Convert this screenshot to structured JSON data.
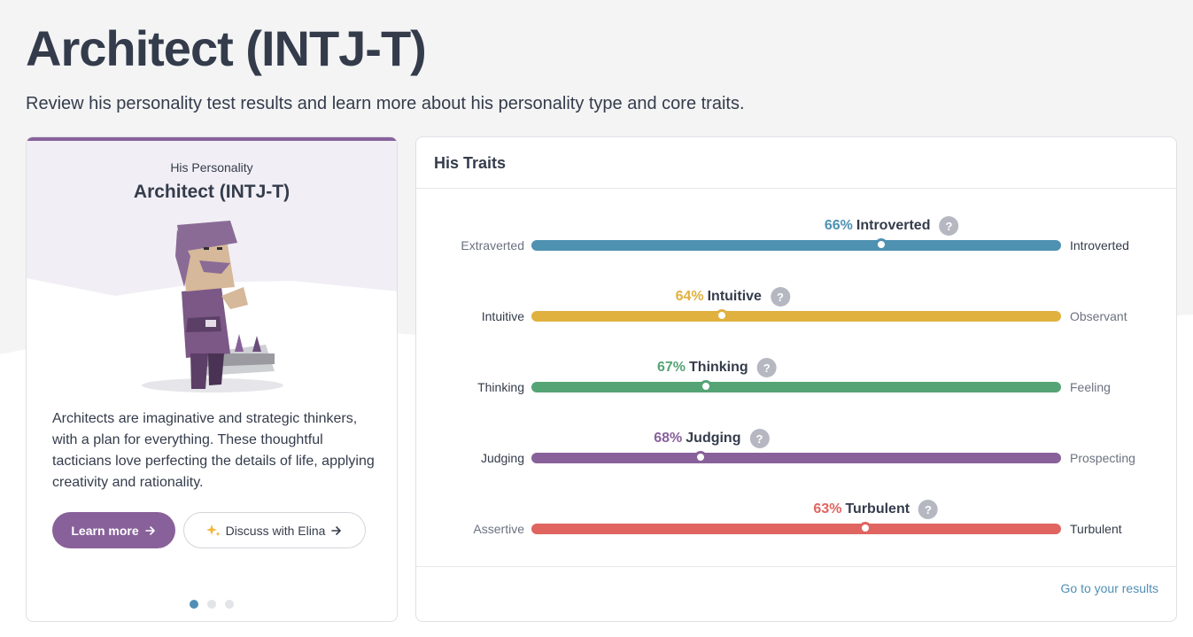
{
  "page": {
    "title": "Architect (INTJ-T)",
    "subtitle": "Review his personality test results and learn more about his personality type and core traits."
  },
  "personality_card": {
    "kicker": "His Personality",
    "type": "Architect (INTJ-T)",
    "description": "Architects are imaginative and strategic thinkers, with a plan for everything. These thoughtful tacticians love perfecting the details of life, applying creativity and rationality.",
    "learn_more_label": "Learn more",
    "discuss_label": "Discuss with Elina",
    "carousel_dots": 3,
    "active_dot": 0,
    "accent_color": "#88619a"
  },
  "traits_card": {
    "title": "His Traits",
    "footer_link": "Go to your results",
    "traits": [
      {
        "percent": "66%",
        "trait": "Introverted",
        "left": "Extraverted",
        "right": "Introverted",
        "position": 0.66,
        "color": "#4e91b1",
        "left_color": "#6b7280",
        "right_color": "#343c4b"
      },
      {
        "percent": "64%",
        "trait": "Intuitive",
        "left": "Intuitive",
        "right": "Observant",
        "position": 0.36,
        "color": "#e0b13f",
        "left_color": "#343c4b",
        "right_color": "#6b7280"
      },
      {
        "percent": "67%",
        "trait": "Thinking",
        "left": "Thinking",
        "right": "Feeling",
        "position": 0.33,
        "color": "#55a475",
        "left_color": "#343c4b",
        "right_color": "#6b7280"
      },
      {
        "percent": "68%",
        "trait": "Judging",
        "left": "Judging",
        "right": "Prospecting",
        "position": 0.32,
        "color": "#88619a",
        "left_color": "#343c4b",
        "right_color": "#6b7280"
      },
      {
        "percent": "63%",
        "trait": "Turbulent",
        "left": "Assertive",
        "right": "Turbulent",
        "position": 0.63,
        "color": "#e06560",
        "left_color": "#6b7280",
        "right_color": "#343c4b"
      }
    ]
  },
  "icons": {
    "arrow": "arrow-right-icon",
    "sparkle": "sparkle-icon",
    "help": "question-icon"
  }
}
